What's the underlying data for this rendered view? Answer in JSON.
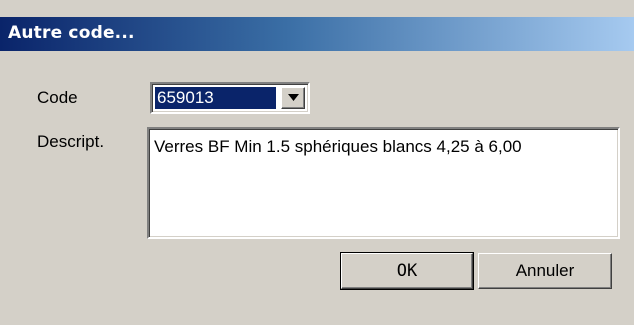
{
  "window": {
    "title": "Autre code..."
  },
  "form": {
    "code_label": "Code",
    "code_value": "659013",
    "description_label": "Descript.",
    "description_value": "Verres BF Min 1.5 sphériques blancs 4,25 à 6,00"
  },
  "buttons": {
    "ok_label": "OK",
    "cancel_label": "Annuler"
  },
  "icons": {
    "dropdown": "chevron-down-icon"
  },
  "colors": {
    "window_bg": "#d4d0c8",
    "titlebar_start": "#0a246a",
    "titlebar_end": "#a6caf0",
    "selection_bg": "#0a246a"
  }
}
